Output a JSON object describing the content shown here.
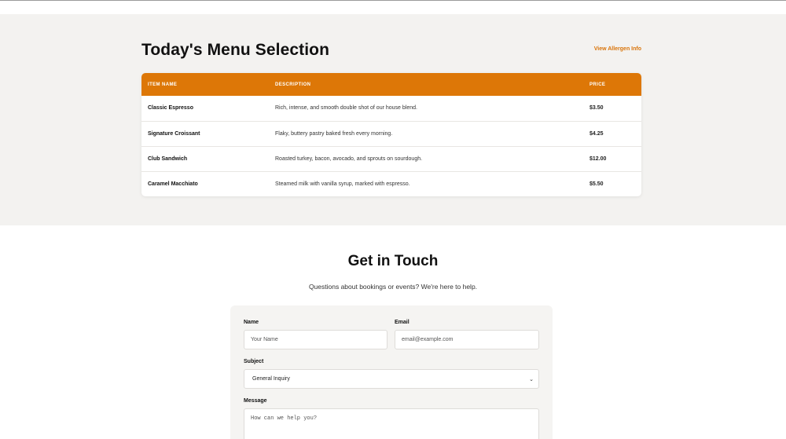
{
  "menu": {
    "title": "Today's Menu Selection",
    "allergen_link": "View Allergen Info",
    "columns": [
      "ITEM NAME",
      "DESCRIPTION",
      "PRICE"
    ],
    "items": [
      {
        "name": "Classic Espresso",
        "description": "Rich, intense, and smooth double shot of our house blend.",
        "price": "$3.50"
      },
      {
        "name": "Signature Croissant",
        "description": "Flaky, buttery pastry baked fresh every morning.",
        "price": "$4.25"
      },
      {
        "name": "Club Sandwich",
        "description": "Roasted turkey, bacon, avocado, and sprouts on sourdough.",
        "price": "$12.00"
      },
      {
        "name": "Caramel Macchiato",
        "description": "Steamed milk with vanilla syrup, marked with espresso.",
        "price": "$5.50"
      }
    ],
    "accent_color": "#dd7707"
  },
  "contact": {
    "title": "Get in Touch",
    "subtitle": "Questions about bookings or events? We're here to help.",
    "name_label": "Name",
    "name_placeholder": "Your Name",
    "email_label": "Email",
    "email_placeholder": "email@example.com",
    "subject_label": "Subject",
    "subject_value": "General Inquiry",
    "message_label": "Message",
    "message_placeholder": "How can we help you?"
  }
}
